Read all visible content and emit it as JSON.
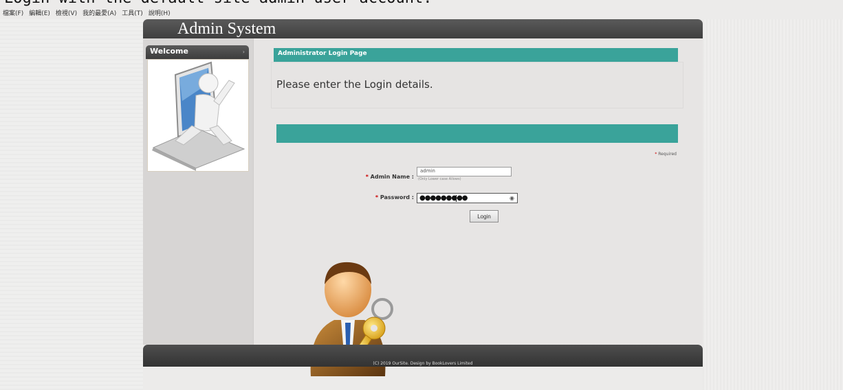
{
  "caption": "Login with the default site admin user account.",
  "menubar": [
    "檔案(F)",
    "編輯(E)",
    "檢視(V)",
    "我的最愛(A)",
    "工具(T)",
    "說明(H)"
  ],
  "header": {
    "title": "Admin System"
  },
  "sidebar": {
    "welcome_title": "Welcome",
    "arrow": "›"
  },
  "login": {
    "page_title": "Administrator Login Page",
    "intro": "Please enter the Login details.",
    "required_note": "Required",
    "admin_label": "Admin Name :",
    "admin_value": "admin",
    "admin_hint": "(Only Lower case Allows)",
    "password_label": "Password :",
    "password_dots": "●●●●●●●●●",
    "password_toggle": "◉",
    "login_button": "Login",
    "required_star": "*"
  },
  "footer": {
    "text": "(C) 2019 OurSite. Design by BookLovers Limited"
  },
  "colors": {
    "accent": "#3aa39a",
    "header": "#4a4a4a",
    "background": "#ecebea"
  }
}
